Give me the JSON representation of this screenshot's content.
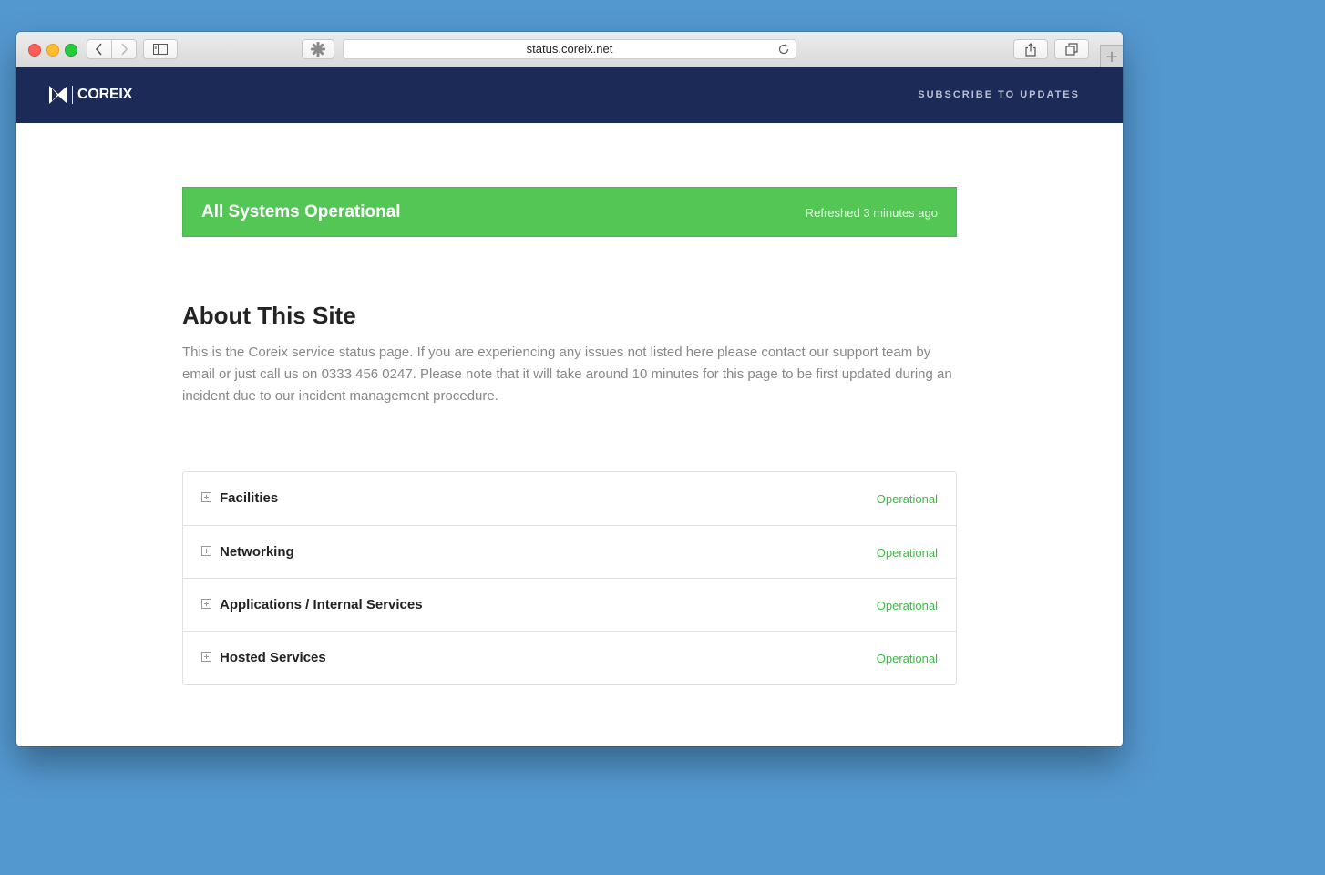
{
  "browser": {
    "url": "status.coreix.net",
    "new_tab_symbol": "+"
  },
  "header": {
    "brand": "COREIX",
    "subscribe_label": "SUBSCRIBE TO UPDATES",
    "bg_color": "#1b2a57"
  },
  "status": {
    "title": "All Systems Operational",
    "refreshed": "Refreshed 3 minutes ago",
    "color": "#54c655"
  },
  "about": {
    "title": "About This Site",
    "text": "This is the Coreix service status page. If you are experiencing any issues not listed here please contact our support team by email or just call us on 0333 456 0247. Please note that it will take around 10 minutes for this page to be first updated during an incident due to our incident management procedure."
  },
  "components": [
    {
      "name": "Facilities",
      "status": "Operational"
    },
    {
      "name": "Networking",
      "status": "Operational"
    },
    {
      "name": "Applications / Internal Services",
      "status": "Operational"
    },
    {
      "name": "Hosted Services",
      "status": "Operational"
    }
  ],
  "colors": {
    "desktop": "#5498d0",
    "operational": "#3dbb45"
  }
}
